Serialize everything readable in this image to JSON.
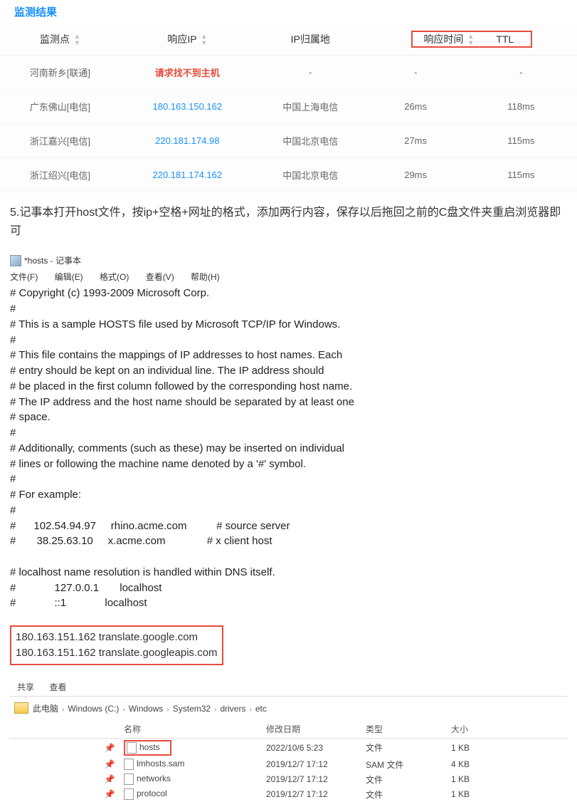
{
  "section_title": "监测结果",
  "table": {
    "headers": {
      "point": "监测点",
      "ip": "响应IP",
      "loc": "IP归属地",
      "time": "响应时间",
      "ttl": "TTL"
    },
    "rows": [
      {
        "point": "河南新乡[联通]",
        "ip": "请求找不到主机",
        "ip_error": true,
        "loc": "-",
        "time": "-",
        "ttl": "-"
      },
      {
        "point": "广东佛山[电信]",
        "ip": "180.163.150.162",
        "loc": "中国上海电信",
        "time": "26ms",
        "ttl": "118ms"
      },
      {
        "point": "浙江嘉兴[电信]",
        "ip": "220.181.174.98",
        "loc": "中国北京电信",
        "time": "27ms",
        "ttl": "115ms"
      },
      {
        "point": "浙江绍兴[电信]",
        "ip": "220.181.174.162",
        "loc": "中国北京电信",
        "time": "29ms",
        "ttl": "115ms"
      }
    ]
  },
  "step5": "5.记事本打开host文件，按ip+空格+网址的格式，添加两行内容，保存以后拖回之前的C盘文件夹重启浏览器即可",
  "notepad": {
    "title": "*hosts - 记事本",
    "menus": {
      "file": "文件(F)",
      "edit": "编辑(E)",
      "format": "格式(O)",
      "view": "查看(V)",
      "help": "帮助(H)"
    },
    "body": "# Copyright (c) 1993-2009 Microsoft Corp.\n#\n# This is a sample HOSTS file used by Microsoft TCP/IP for Windows.\n#\n# This file contains the mappings of IP addresses to host names. Each\n# entry should be kept on an individual line. The IP address should\n# be placed in the first column followed by the corresponding host name.\n# The IP address and the host name should be separated by at least one\n# space.\n#\n# Additionally, comments (such as these) may be inserted on individual\n# lines or following the machine name denoted by a '#' symbol.\n#\n# For example:\n#\n#      102.54.94.97     rhino.acme.com          # source server\n#       38.25.63.10     x.acme.com              # x client host\n\n# localhost name resolution is handled within DNS itself.\n#             127.0.0.1       localhost\n#             ::1             localhost",
    "added": "180.163.151.162 translate.google.com\n180.163.151.162 translate.googleapis.com"
  },
  "explorer": {
    "share": "共享",
    "view": "查看",
    "path": [
      "此电脑",
      "Windows (C:)",
      "Windows",
      "System32",
      "drivers",
      "etc"
    ],
    "cols": {
      "name": "名称",
      "date": "修改日期",
      "type": "类型",
      "size": "大小"
    },
    "files": [
      {
        "name": "hosts",
        "date": "2022/10/6 5:23",
        "type": "文件",
        "size": "1 KB",
        "hl": true
      },
      {
        "name": "lmhosts.sam",
        "date": "2019/12/7 17:12",
        "type": "SAM 文件",
        "size": "4 KB"
      },
      {
        "name": "networks",
        "date": "2019/12/7 17:12",
        "type": "文件",
        "size": "1 KB"
      },
      {
        "name": "protocol",
        "date": "2019/12/7 17:12",
        "type": "文件",
        "size": "1 KB"
      }
    ]
  }
}
